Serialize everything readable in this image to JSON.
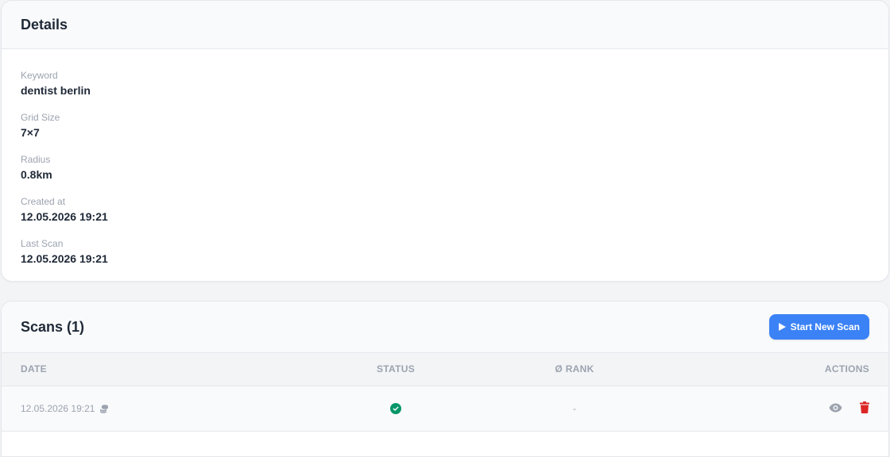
{
  "details": {
    "title": "Details",
    "fields": [
      {
        "label": "Keyword",
        "value": "dentist berlin"
      },
      {
        "label": "Grid Size",
        "value": "7×7"
      },
      {
        "label": "Radius",
        "value": "0.8km"
      },
      {
        "label": "Created at",
        "value": "12.05.2026 19:21"
      },
      {
        "label": "Last Scan",
        "value": "12.05.2026 19:21"
      }
    ]
  },
  "scans": {
    "title": "Scans (1)",
    "start_button_label": "Start New Scan",
    "columns": {
      "date": "DATE",
      "status": "STATUS",
      "rank": "Ø RANK",
      "actions": "ACTIONS"
    },
    "rows": [
      {
        "date": "12.05.2026 19:21",
        "status": "success",
        "rank": "-"
      }
    ]
  },
  "colors": {
    "accent": "#3b82f6",
    "success": "#059669",
    "danger": "#dc2626"
  },
  "icons": {
    "start": "play-icon",
    "coins": "coins-icon",
    "status": "check-circle-icon",
    "view": "eye-icon",
    "delete": "trash-icon"
  }
}
